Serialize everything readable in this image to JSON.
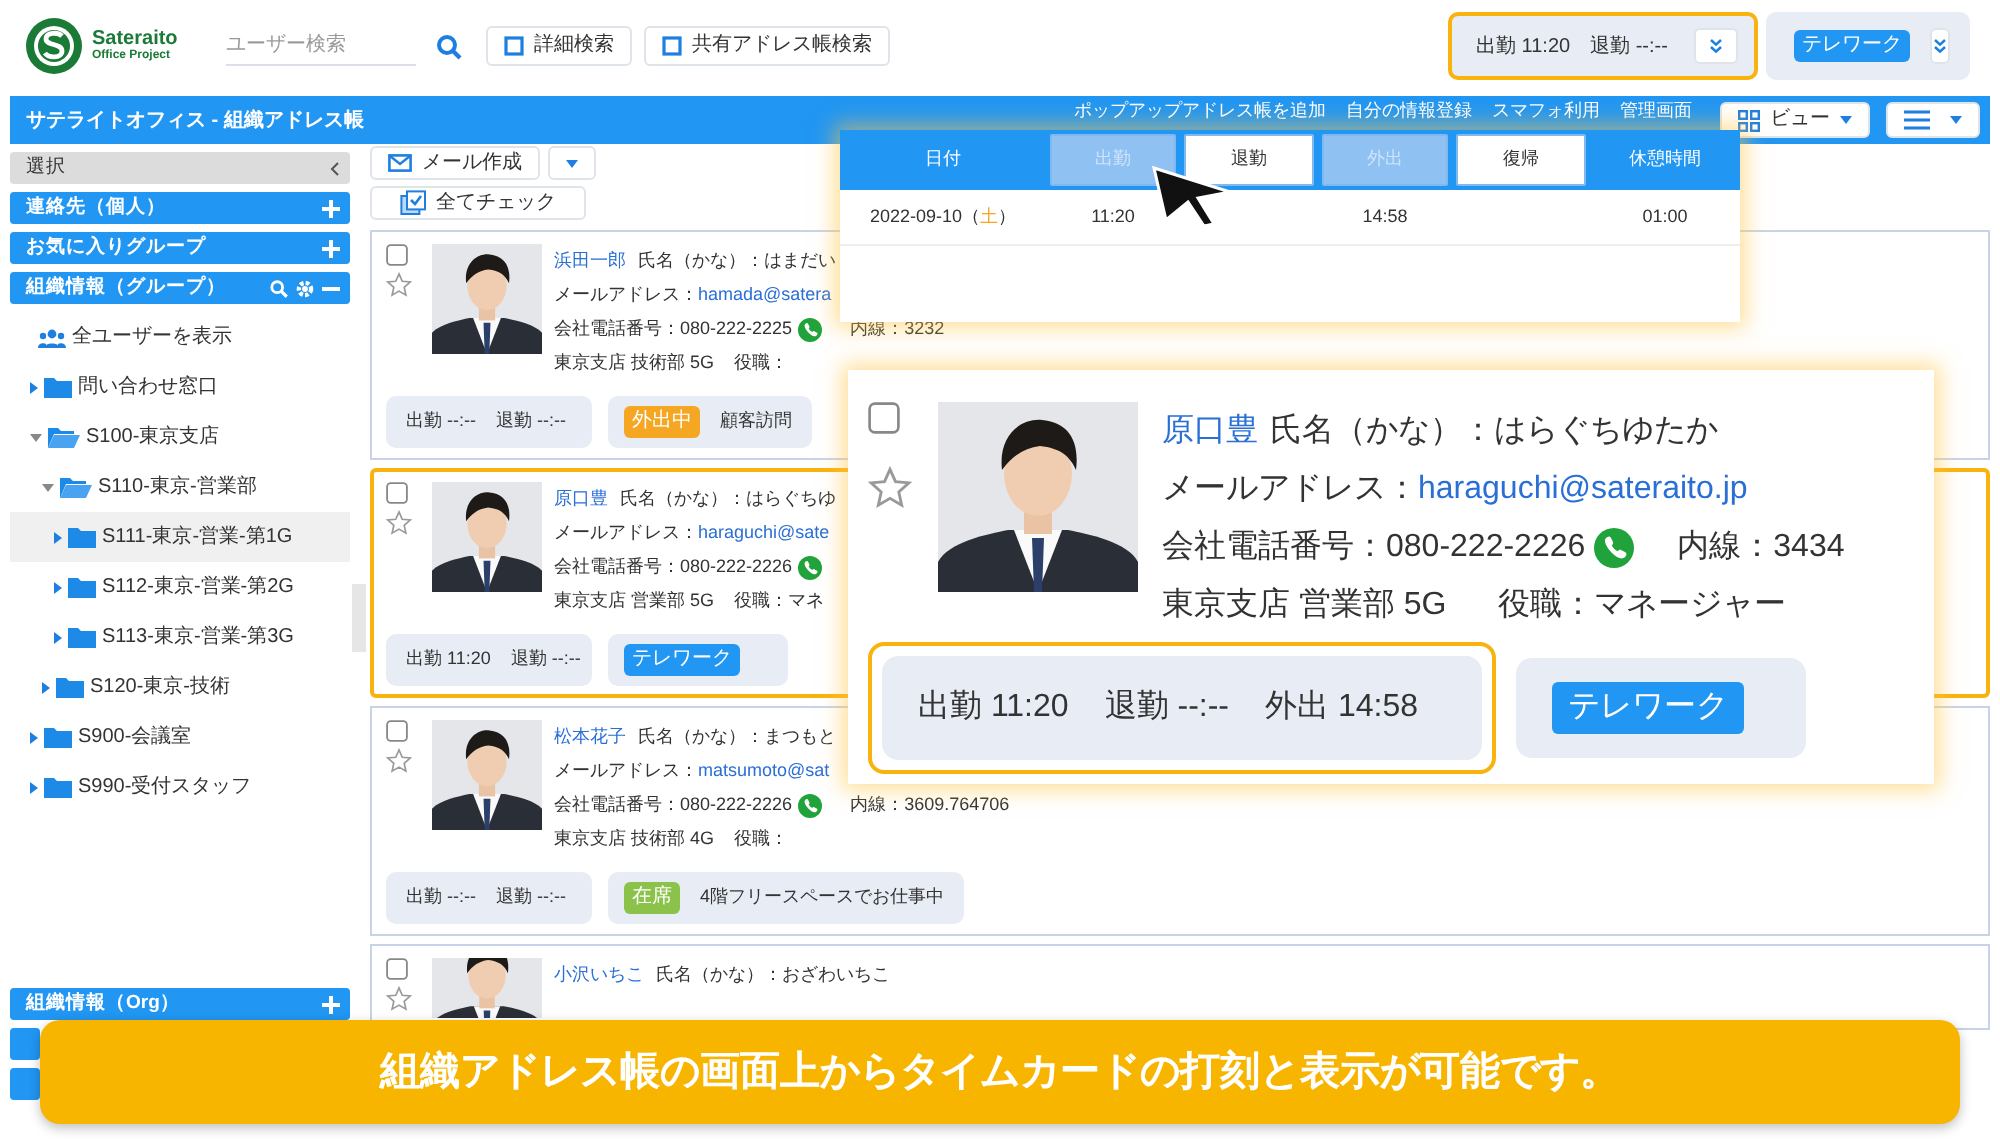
{
  "header": {
    "logo": {
      "name": "Sateraito",
      "tagline": "Office Project"
    },
    "search": {
      "placeholder": "ユーザー検索"
    },
    "buttons": [
      "詳細検索",
      "共有アドレス帳検索"
    ],
    "attendance": {
      "items": [
        "出勤 11:20",
        "退勤 --:--"
      ],
      "highlighted": true
    },
    "status": {
      "tag": "テレワーク",
      "color": "#2196f3"
    }
  },
  "title_bar": {
    "title": "サテライトオフィス - 組織アドレス帳",
    "links": [
      "ポップアップアドレス帳を追加",
      "自分の情報登録",
      "スマフォ利用",
      "管理画面"
    ],
    "view_button": "ビュー"
  },
  "sidebar": {
    "sections": [
      {
        "label": "選択",
        "kind": "select"
      },
      {
        "label": "連絡先（個人）",
        "kind": "add"
      },
      {
        "label": "お気に入りグループ",
        "kind": "add"
      },
      {
        "label": "組織情報（グループ）",
        "kind": "tools"
      }
    ],
    "tree": [
      {
        "label": "全ユーザーを表示",
        "kind": "users"
      },
      {
        "label": "問い合わせ窓口",
        "kind": "folder",
        "expanded": false,
        "selected": false
      },
      {
        "label": "S100-東京支店",
        "kind": "folder",
        "expanded": true,
        "selected": false,
        "children": [
          {
            "label": "S110-東京-営業部",
            "kind": "folder",
            "expanded": true,
            "selected": false,
            "children": [
              {
                "label": "S111-東京-営業-第1G",
                "kind": "folder",
                "expanded": false,
                "selected": true
              },
              {
                "label": "S112-東京-営業-第2G",
                "kind": "folder",
                "expanded": false,
                "selected": false
              },
              {
                "label": "S113-東京-営業-第3G",
                "kind": "folder",
                "expanded": false,
                "selected": false
              }
            ]
          },
          {
            "label": "S120-東京-技術",
            "kind": "folder",
            "expanded": false,
            "selected": false
          }
        ]
      },
      {
        "label": "S900-会議室",
        "kind": "folder",
        "expanded": false,
        "selected": false
      },
      {
        "label": "S990-受付スタッフ",
        "kind": "folder",
        "expanded": false,
        "selected": false
      }
    ],
    "bottom_sections": [
      {
        "label": "組織情報（Org）",
        "kind": "add"
      },
      {
        "kind": "covered"
      },
      {
        "kind": "covered"
      }
    ]
  },
  "toolbar": {
    "compose": "メール作成",
    "check_all": "全てチェック"
  },
  "cards": [
    {
      "name": "浜田一郎",
      "kana": "氏名（かな）：はまだい",
      "email_label": "メールアドレス：",
      "email": "hamada@satera",
      "phone": "会社電話番号：080-222-2225",
      "extension": "内線：3232",
      "department": "東京支店 技術部 5G",
      "role": "役職：",
      "attendance": [
        "出勤 --:--",
        "退勤 --:--"
      ],
      "status": {
        "tag": "外出中",
        "color": "#f5a623",
        "note": "顧客訪問"
      },
      "highlighted": false,
      "checked": false
    },
    {
      "name": "原口豊",
      "kana": "氏名（かな）：はらぐちゆ",
      "email_label": "メールアドレス：",
      "email": "haraguchi@sate",
      "phone": "会社電話番号：080-222-2226",
      "department": "東京支店 営業部 5G",
      "role": "役職：マネ",
      "attendance": [
        "出勤 11:20",
        "退勤 --:--"
      ],
      "status": {
        "tag": "テレワーク",
        "color": "#2196f3"
      },
      "highlighted": true,
      "checked": false
    },
    {
      "name": "松本花子",
      "kana": "氏名（かな）：まつもと",
      "email_label": "メールアドレス：",
      "email": "matsumoto@sat",
      "phone": "会社電話番号：080-222-2226",
      "extension": "内線：3609.764706",
      "department": "東京支店 技術部 4G",
      "role": "役職：",
      "attendance": [
        "出勤 --:--",
        "退勤 --:--"
      ],
      "status": {
        "tag": "在席",
        "color": "#8bc34a",
        "note": "4階フリースペースでお仕事中"
      },
      "highlighted": false,
      "checked": false
    },
    {
      "name": "小沢いちこ",
      "kana": "氏名（かな）：おざわいちこ",
      "highlighted": false,
      "checked": false
    }
  ],
  "timecard_popup": {
    "columns": [
      {
        "label": "日付",
        "kind": "heading",
        "value_parts": [
          {
            "text": "2022-09-10（"
          },
          {
            "text": "土",
            "color": "#f5a623"
          },
          {
            "text": "）"
          }
        ]
      },
      {
        "label": "出勤",
        "kind": "button",
        "disabled": true,
        "value": "11:20"
      },
      {
        "label": "退勤",
        "kind": "button",
        "disabled": false
      },
      {
        "label": "外出",
        "kind": "button",
        "disabled": true,
        "value": "14:58"
      },
      {
        "label": "復帰",
        "kind": "button",
        "disabled": false
      },
      {
        "label": "休憩時間",
        "kind": "heading",
        "value": "01:00"
      }
    ]
  },
  "zoom_callout": {
    "name": "原口豊",
    "kana": "氏名（かな）：はらぐちゆたか",
    "email_label": "メールアドレス：",
    "email": "haraguchi@sateraito.jp",
    "phone": "会社電話番号：080-222-2226",
    "extension": "内線：3434",
    "department": "東京支店 営業部 5G",
    "role": "役職：マネージャー",
    "attendance": [
      "出勤 11:20",
      "退勤 --:--",
      "外出 14:58"
    ],
    "attendance_highlighted": true,
    "status": {
      "tag": "テレワーク",
      "color": "#2196f3"
    },
    "checked": false
  },
  "banner": {
    "text": "組織アドレス帳の画面上からタイムカードの打刻と表示が可能です。"
  }
}
